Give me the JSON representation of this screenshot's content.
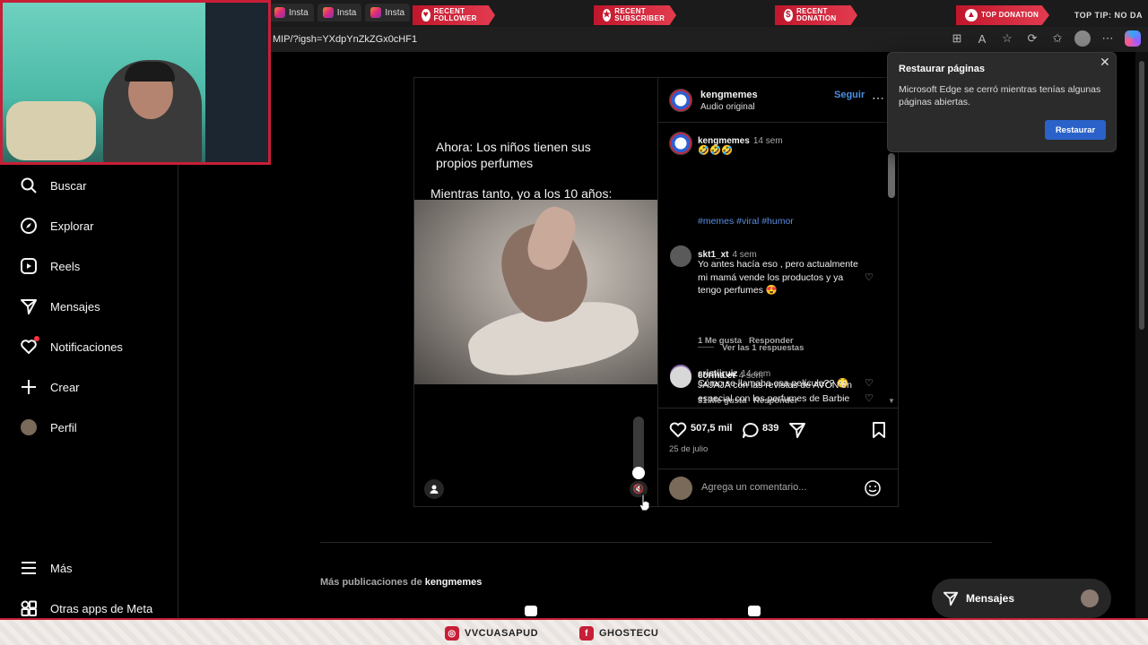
{
  "stream": {
    "tabs": [
      "Insta",
      "Insta",
      "Insta"
    ],
    "badges": {
      "follower": "RECENT FOLLOWER",
      "subscriber": "RECENT SUBSCRIBER",
      "donation": "RECENT DONATION",
      "top_donation": "TOP DONATION"
    },
    "top_tip": "TOP TIP: NO DA",
    "socials": [
      "VVCUASAPUD",
      "GHOSTECU"
    ]
  },
  "browser": {
    "url": "MIP/?igsh=YXdpYnZkZGx0cHF1"
  },
  "nav": {
    "items": [
      {
        "label": "Buscar"
      },
      {
        "label": "Explorar"
      },
      {
        "label": "Reels"
      },
      {
        "label": "Mensajes"
      },
      {
        "label": "Notificaciones"
      },
      {
        "label": "Crear"
      },
      {
        "label": "Perfil"
      }
    ],
    "more": "Más",
    "meta_apps": "Otras apps de Meta"
  },
  "post": {
    "media": {
      "caption_line1": "Ahora: Los niños tienen sus propios perfumes",
      "caption_line2": "Mientras tanto, yo a los 10 años:"
    },
    "header": {
      "username": "kengmemes",
      "audio": "Audio original",
      "follow": "Seguir"
    },
    "owner_comment": {
      "username": "kengmemes",
      "time": "14 sem",
      "text": "🤣🤣🤣",
      "tags": "#memes #viral #humor"
    },
    "comments": [
      {
        "username": "skt1_xt",
        "time": "4 sem",
        "text": "Yo antes hacía eso , pero actualmente mi mamá vende los productos y ya tengo perfumes 😍",
        "likes": "1 Me gusta",
        "reply": "Responder"
      },
      {
        "username": "cristiiruiz",
        "time": "14 sem",
        "text": "Cómo se llamaba esa película?? 😳",
        "likes": "31 Me gusta",
        "reply": "Responder",
        "view_replies": "Ver las 1 respuestas"
      },
      {
        "username": "corina.et",
        "time": "4 sem",
        "text": "JAJAJA con las revistas de AVON en especial con los perfumes de Barbie"
      }
    ],
    "likes": "507,5 mil",
    "comment_count": "839",
    "date": "25 de julio",
    "add_comment_placeholder": "Agrega un comentario..."
  },
  "more_posts": {
    "prefix": "Más publicaciones de ",
    "username": "kengmemes"
  },
  "restore_popup": {
    "title": "Restaurar páginas",
    "message": "Microsoft Edge se cerró mientras tenías algunas páginas abiertas.",
    "button": "Restaurar"
  },
  "messages_pill": {
    "label": "Mensajes"
  },
  "colors": {
    "accent_blue": "#4a90e2",
    "hashtag": "#5a8de0",
    "notif_dot": "#ff3040",
    "stream_red": "#c71f37",
    "edge_button": "#2a62c9"
  }
}
